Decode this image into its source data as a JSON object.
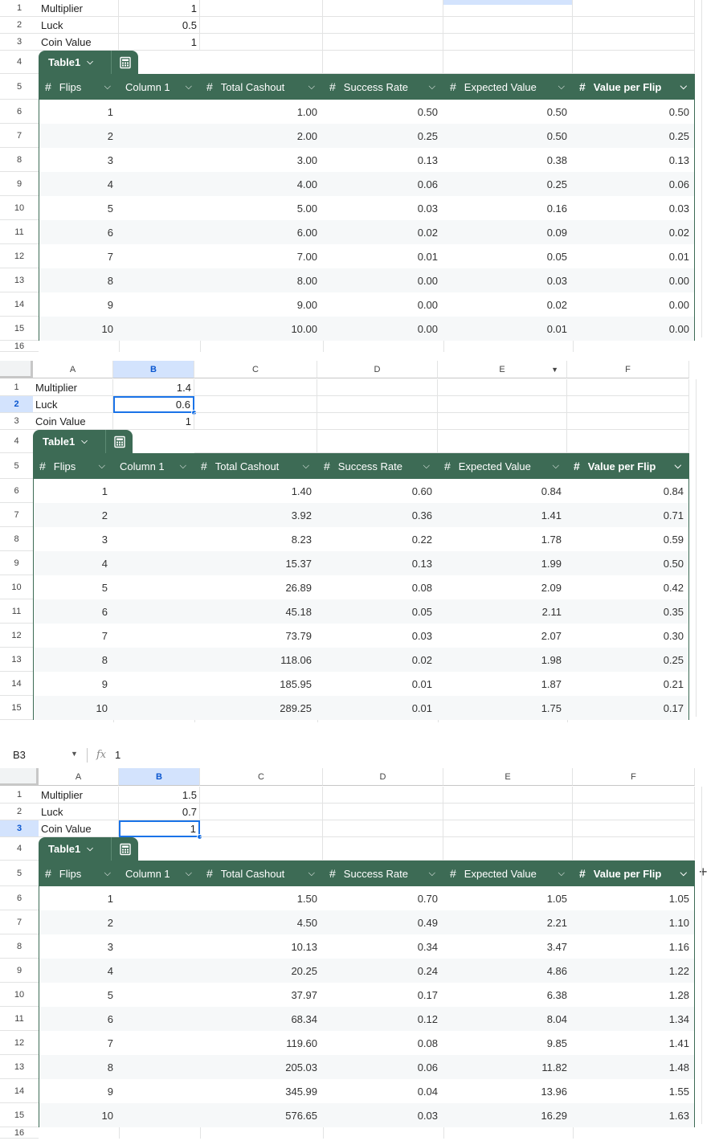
{
  "formula_bar": {
    "cell_ref": "B3",
    "fx": "fx",
    "value": "1"
  },
  "columns": [
    "A",
    "B",
    "C",
    "D",
    "E",
    "F"
  ],
  "row_numbers": [
    "1",
    "2",
    "3",
    "4",
    "5",
    "6",
    "7",
    "8",
    "9",
    "10",
    "11",
    "12",
    "13",
    "14",
    "15",
    "16"
  ],
  "table": {
    "name": "Table1",
    "headers": [
      {
        "label": "Flips",
        "type_icon": "#"
      },
      {
        "label": "Column 1",
        "type_icon": ""
      },
      {
        "label": "Total Cashout",
        "type_icon": "#"
      },
      {
        "label": "Success Rate",
        "type_icon": "#"
      },
      {
        "label": "Expected Value",
        "type_icon": "#"
      },
      {
        "label": "Value per Flip",
        "type_icon": "#"
      }
    ]
  },
  "sheets": [
    {
      "params": [
        {
          "label": "Multiplier",
          "value": "1"
        },
        {
          "label": "Luck",
          "value": "0.5"
        },
        {
          "label": "Coin Value",
          "value": "1"
        }
      ],
      "rows": [
        [
          "1",
          "",
          "1.00",
          "0.50",
          "0.50",
          "0.50"
        ],
        [
          "2",
          "",
          "2.00",
          "0.25",
          "0.50",
          "0.25"
        ],
        [
          "3",
          "",
          "3.00",
          "0.13",
          "0.38",
          "0.13"
        ],
        [
          "4",
          "",
          "4.00",
          "0.06",
          "0.25",
          "0.06"
        ],
        [
          "5",
          "",
          "5.00",
          "0.03",
          "0.16",
          "0.03"
        ],
        [
          "6",
          "",
          "6.00",
          "0.02",
          "0.09",
          "0.02"
        ],
        [
          "7",
          "",
          "7.00",
          "0.01",
          "0.05",
          "0.01"
        ],
        [
          "8",
          "",
          "8.00",
          "0.00",
          "0.03",
          "0.00"
        ],
        [
          "9",
          "",
          "9.00",
          "0.00",
          "0.02",
          "0.00"
        ],
        [
          "10",
          "",
          "10.00",
          "0.00",
          "0.01",
          "0.00"
        ]
      ]
    },
    {
      "params": [
        {
          "label": "Multiplier",
          "value": "1.4"
        },
        {
          "label": "Luck",
          "value": "0.6"
        },
        {
          "label": "Coin Value",
          "value": "1"
        }
      ],
      "rows": [
        [
          "1",
          "",
          "1.40",
          "0.60",
          "0.84",
          "0.84"
        ],
        [
          "2",
          "",
          "3.92",
          "0.36",
          "1.41",
          "0.71"
        ],
        [
          "3",
          "",
          "8.23",
          "0.22",
          "1.78",
          "0.59"
        ],
        [
          "4",
          "",
          "15.37",
          "0.13",
          "1.99",
          "0.50"
        ],
        [
          "5",
          "",
          "26.89",
          "0.08",
          "2.09",
          "0.42"
        ],
        [
          "6",
          "",
          "45.18",
          "0.05",
          "2.11",
          "0.35"
        ],
        [
          "7",
          "",
          "73.79",
          "0.03",
          "2.07",
          "0.30"
        ],
        [
          "8",
          "",
          "118.06",
          "0.02",
          "1.98",
          "0.25"
        ],
        [
          "9",
          "",
          "185.95",
          "0.01",
          "1.87",
          "0.21"
        ],
        [
          "10",
          "",
          "289.25",
          "0.01",
          "1.75",
          "0.17"
        ]
      ]
    },
    {
      "params": [
        {
          "label": "Multiplier",
          "value": "1.5"
        },
        {
          "label": "Luck",
          "value": "0.7"
        },
        {
          "label": "Coin Value",
          "value": "1"
        }
      ],
      "rows": [
        [
          "1",
          "",
          "1.50",
          "0.70",
          "1.05",
          "1.05"
        ],
        [
          "2",
          "",
          "4.50",
          "0.49",
          "2.21",
          "1.10"
        ],
        [
          "3",
          "",
          "10.13",
          "0.34",
          "3.47",
          "1.16"
        ],
        [
          "4",
          "",
          "20.25",
          "0.24",
          "4.86",
          "1.22"
        ],
        [
          "5",
          "",
          "37.97",
          "0.17",
          "6.38",
          "1.28"
        ],
        [
          "6",
          "",
          "68.34",
          "0.12",
          "8.04",
          "1.34"
        ],
        [
          "7",
          "",
          "119.60",
          "0.08",
          "9.85",
          "1.41"
        ],
        [
          "8",
          "",
          "205.03",
          "0.06",
          "11.82",
          "1.48"
        ],
        [
          "9",
          "",
          "345.99",
          "0.04",
          "13.96",
          "1.55"
        ],
        [
          "10",
          "",
          "576.65",
          "0.03",
          "16.29",
          "1.63"
        ]
      ]
    }
  ]
}
